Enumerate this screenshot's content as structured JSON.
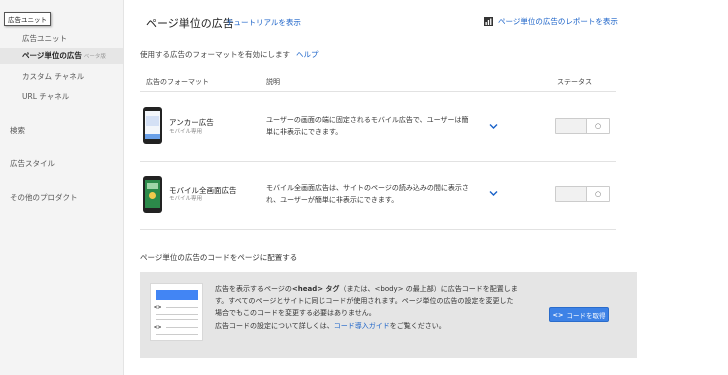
{
  "sidebar": {
    "tooltip": "広告ユニット",
    "items": [
      {
        "label": "広告ユニット"
      },
      {
        "label": "ページ単位の広告",
        "badge": "ベータ版"
      },
      {
        "label": "カスタム チャネル"
      },
      {
        "label": "URL チャネル"
      }
    ],
    "sections": [
      "検索",
      "広告スタイル",
      "その他のプロダクト"
    ]
  },
  "header": {
    "title": "ページ単位の広告",
    "tutorial_link": "チュートリアルを表示",
    "report_link": "ページ単位の広告のレポートを表示",
    "report_icon": "bar-chart-icon"
  },
  "formats": {
    "enable_text": "使用する広告のフォーマットを有効にします",
    "help_link": "ヘルプ",
    "columns": {
      "format": "広告のフォーマット",
      "description": "説明",
      "status": "ステータス"
    },
    "rows": [
      {
        "name": "アンカー広告",
        "sub": "モバイル専用",
        "desc_1": "ユーザーの画面の端に固定されるモバイル広告で、ユーザーは簡",
        "desc_2": "単に非表示にできます。",
        "toggle_symbol": "○"
      },
      {
        "name": "モバイル全画面広告",
        "sub": "モバイル専用",
        "desc_1": "モバイル全画面広告は、サイトのページの読み込みの間に表示さ",
        "desc_2": "れ、ユーザーが簡単に非表示にできます。",
        "toggle_symbol": "○"
      }
    ]
  },
  "code_section": {
    "title": "ページ単位の広告のコードをページに配置する",
    "illus_tag": "<>",
    "p1_a": "広告を表示するページの",
    "p1_b": "<head> タグ",
    "p1_c": "（または、<body> の最上部）に広告コードを配置しま",
    "p1_d": "す。すべてのページとサイトに同じコードが使用されます。ページ単位の広告の設定を変更した",
    "p1_e": "場合でもこのコードを変更する必要はありません。",
    "p2_a": "広告コードの設定について詳しくは、",
    "p2_link": "コード導入ガイド",
    "p2_b": "をご覧ください。",
    "button_label": "コードを取得",
    "button_icon": "<>"
  },
  "colors": {
    "link": "#1a62c8",
    "button": "#3d82e6",
    "code_bar": "#4285f4",
    "sidebar_bg": "#f4f4f4",
    "code_box_bg": "#e5e5e5"
  }
}
